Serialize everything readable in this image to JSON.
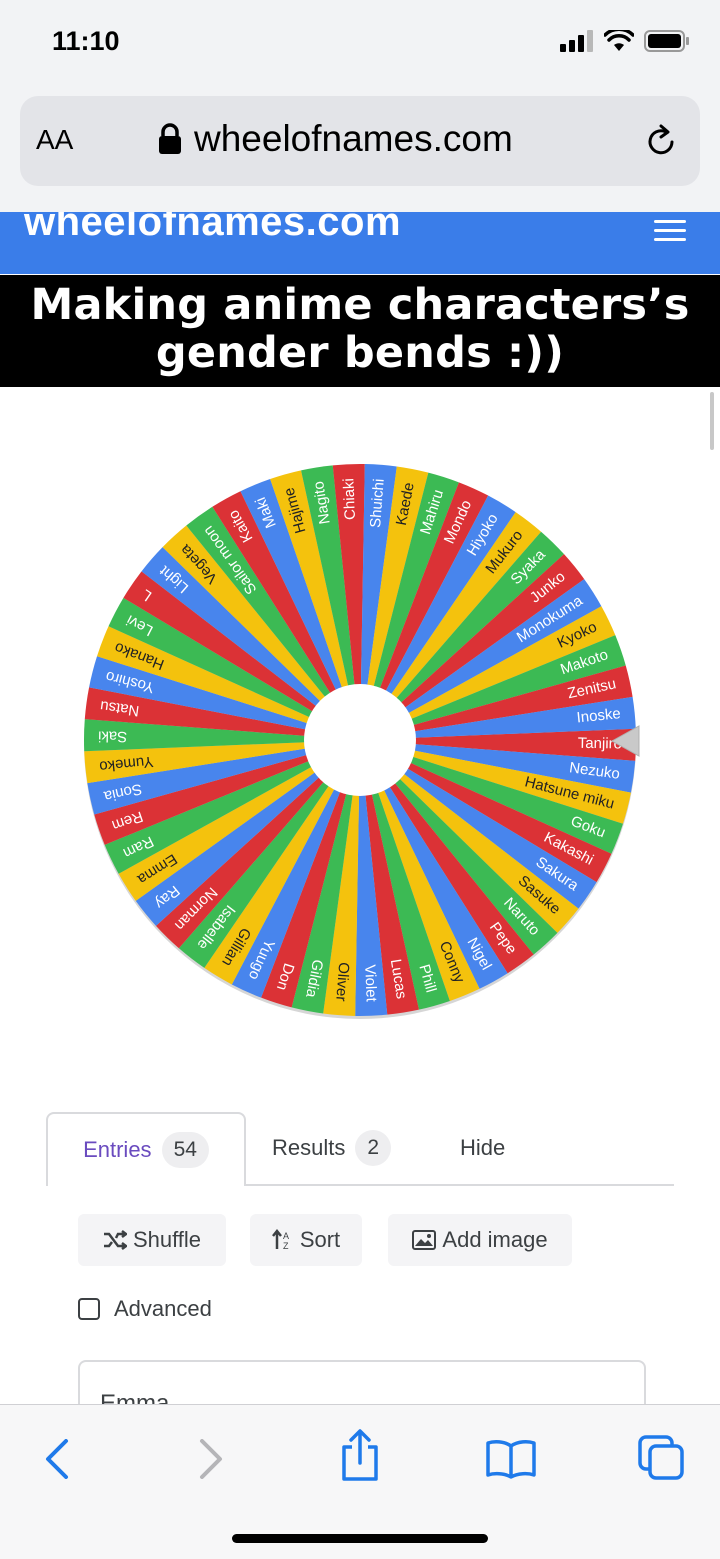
{
  "status": {
    "time": "11:10"
  },
  "browser": {
    "aa_label": "AA",
    "url": "wheelofnames.com"
  },
  "site": {
    "logo": "wheelofnames.com"
  },
  "caption": {
    "line1": "Making anime characters’s",
    "line2": "gender bends :))"
  },
  "wheel": {
    "colors": [
      "#db3236",
      "#4885ed",
      "#f4c20d",
      "#3cba54"
    ],
    "pointer_label": "Tanjiro",
    "entries": [
      "Tanjiro",
      "Nezuko",
      "Hatsune miku",
      "Goku",
      "Kakashi",
      "Sakura",
      "Sasuke",
      "Naruto",
      "Pepe",
      "Nigel",
      "Conny",
      "Phill",
      "Lucas",
      "Violet",
      "Oliver",
      "Gildia",
      "Don",
      "Yuugo",
      "Gillian",
      "Isabelle",
      "Norman",
      "Ray",
      "Emma",
      "Ram",
      "Rem",
      "Sonia",
      "Yumeko",
      "Saki",
      "Natsu",
      "Yoshiro",
      "Hanako",
      "Levi",
      "L",
      "Light",
      "Vegeta",
      "Sailor moon",
      "Kaito",
      "Maki",
      "Hajime",
      "Nagito",
      "Chiaki",
      "Shuichi",
      "Kaede",
      "Mahiru",
      "Mondo",
      "Hiyoko",
      "Mukuro",
      "Syaka",
      "Junko",
      "Monokuma",
      "Kyoko",
      "Makoto",
      "Zenitsu",
      "Inoske"
    ]
  },
  "tabs": [
    {
      "label": "Entries",
      "count": "54"
    },
    {
      "label": "Results",
      "count": "2"
    },
    {
      "label": "Hide"
    }
  ],
  "buttons": {
    "shuffle": "Shuffle",
    "sort": "Sort",
    "add_image": "Add image"
  },
  "advanced_label": "Advanced",
  "entries_first": "Emma"
}
